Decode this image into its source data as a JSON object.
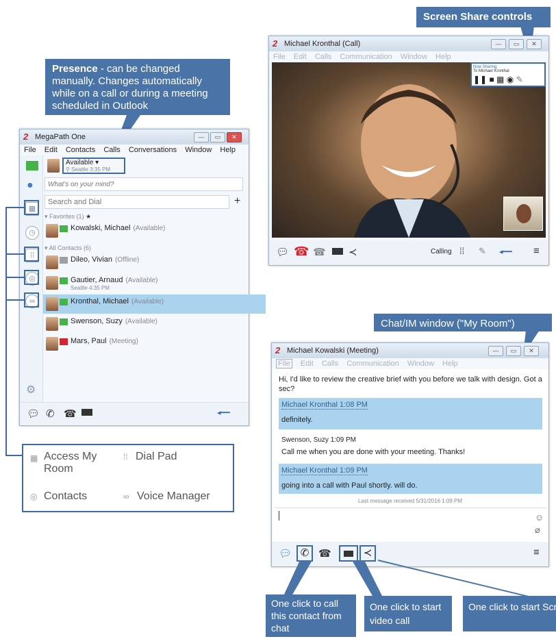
{
  "callouts": {
    "presence_title": "Presence",
    "presence_text": " - can be changed manually. Changes automatically while on a call or during a meeting scheduled in Outlook",
    "screen_share": "Screen Share controls",
    "chat_window": "Chat/IM window (\"My Room\")",
    "call_contact": "One click to call this contact from chat",
    "video_call": "One click to start video call",
    "screen_share_start": "One click to start Screen Share"
  },
  "main_window": {
    "title": "MegaPath One",
    "menu": [
      "File",
      "Edit",
      "Contacts",
      "Calls",
      "Conversations",
      "Window",
      "Help"
    ],
    "presence_status": "Available ▾",
    "presence_location": "Seattle",
    "presence_time": "3:35 PM",
    "mind_placeholder": "What's on your mind?",
    "search_placeholder": "Search and Dial",
    "favorites_header": "Favorites (1)",
    "all_contacts_header": "All Contacts (6)",
    "contacts": [
      {
        "name": "Kowalski, Michael",
        "status": "(Available)",
        "flag": "#46b34a"
      },
      {
        "name": "Dileo, Vivian",
        "status": "(Offline)",
        "flag": "#9aa0a6"
      },
      {
        "name": "Gautier, Arnaud",
        "status": "(Available)",
        "sub": "Seattle 4:35 PM",
        "flag": "#46b34a"
      },
      {
        "name": "Kronthal, Michael",
        "status": "(Available)",
        "flag": "#46b34a",
        "selected": true
      },
      {
        "name": "Swenson, Suzy",
        "status": "(Available)",
        "flag": "#46b34a"
      },
      {
        "name": "Mars, Paul",
        "status": "(Meeting)",
        "flag": "#d9232e"
      }
    ]
  },
  "legend": {
    "access_my_room": "Access My Room",
    "dial_pad": "Dial Pad",
    "contacts": "Contacts",
    "voice_manager": "Voice Manager"
  },
  "call_window": {
    "title": "Michael Kronthal (Call)",
    "menu": [
      "File",
      "Edit",
      "Calls",
      "Communication",
      "Window",
      "Help"
    ],
    "now_sharing": "Now Sharing",
    "sharing_to": "To Michael Kronthal",
    "status": "Calling"
  },
  "chat_window": {
    "title": "Michael Kowalski (Meeting)",
    "menu": [
      "File",
      "Edit",
      "Calls",
      "Communication",
      "Window",
      "Help"
    ],
    "messages": [
      {
        "text": "Hi, I'd like to review the creative brief with you before we talk with design. Got a sec?"
      },
      {
        "sender": "Michael Kronthal 1:08 PM",
        "text": "definitely.",
        "highlight": true
      },
      {
        "sender": "Swenson, Suzy 1:09 PM",
        "text": "Call me when you are done with your meeting. Thanks!"
      },
      {
        "sender": "Michael Kronthal 1:09 PM",
        "text": "going into a call with Paul shortly. will do.",
        "highlight": true
      }
    ],
    "last_received": "Last message received 5/31/2016 1:09 PM"
  },
  "colors": {
    "accent": "#4a73a8",
    "selected_row": "#a9d3ef",
    "available": "#46b34a",
    "meeting": "#d9232e"
  }
}
